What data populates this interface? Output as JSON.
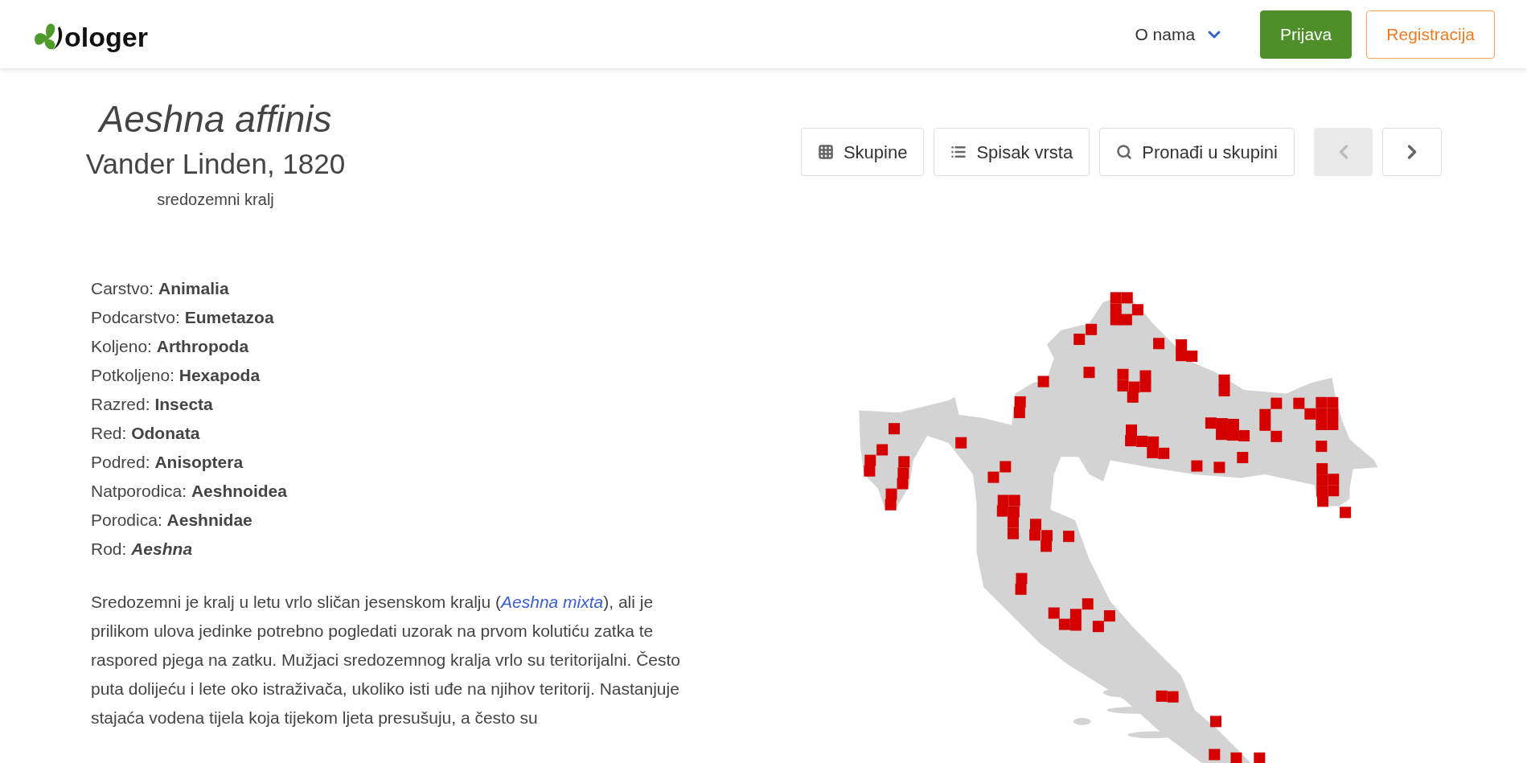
{
  "header": {
    "logo_text": "ologer",
    "menu": {
      "label": "O nama"
    },
    "buttons": [
      {
        "label": "Prijava",
        "kind": "primary"
      },
      {
        "label": "Registracija",
        "kind": "outline"
      }
    ]
  },
  "species": {
    "name": "Aeshna affinis",
    "author": "Vander Linden, 1820",
    "common_name": "sredozemni kralj"
  },
  "toolbar": {
    "buttons": [
      {
        "label": "Skupine",
        "kind": "grid"
      },
      {
        "label": "Spisak vrsta",
        "kind": "list"
      },
      {
        "label": "Pronađi u skupini",
        "kind": "search"
      }
    ],
    "prev": {
      "disabled": true
    },
    "next": {
      "disabled": false
    }
  },
  "taxonomy": [
    {
      "rank": "Carstvo:",
      "value": "Animalia",
      "italic": false
    },
    {
      "rank": "Podcarstvo:",
      "value": "Eumetazoa",
      "italic": false
    },
    {
      "rank": "Koljeno:",
      "value": "Arthropoda",
      "italic": false
    },
    {
      "rank": "Potkoljeno:",
      "value": "Hexapoda",
      "italic": false
    },
    {
      "rank": "Razred:",
      "value": "Insecta",
      "italic": false
    },
    {
      "rank": "Red:",
      "value": "Odonata",
      "italic": false
    },
    {
      "rank": "Podred:",
      "value": "Anisoptera",
      "italic": false
    },
    {
      "rank": "Natporodica:",
      "value": "Aeshnoidea",
      "italic": false
    },
    {
      "rank": "Porodica:",
      "value": "Aeshnidae",
      "italic": false
    },
    {
      "rank": "Rod:",
      "value": "Aeshna",
      "italic": true
    }
  ],
  "description": {
    "before": "Sredozemni je kralj u letu vrlo sličan jesenskom kralju (",
    "link": "Aeshna mixta",
    "after": "), ali je prilikom ulova jedinke potrebno pogledati uzorak na prvom kolutiću zatka te raspored pjega na zatku. Mužjaci sredozemnog kralja vrlo su teritorijalni. Često puta dolijeću i lete oko istraživača, ukoliko isti uđe na njihov teritorij. Nastanjuje stajaća vodena tijela koja tijekom ljeta presušuju, a često su"
  }
}
